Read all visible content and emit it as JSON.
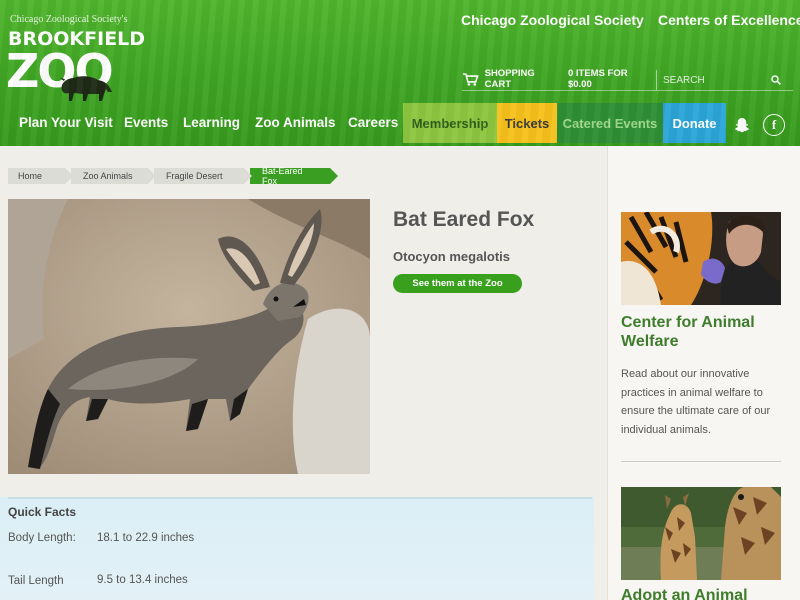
{
  "header": {
    "logo": {
      "society": "Chicago Zoological Society's",
      "name_top": "BROOKFIELD",
      "name_bottom": "ZOO"
    },
    "top_links": [
      "Chicago Zoological Society",
      "Centers of Excellence"
    ],
    "cart": {
      "label": "SHOPPING CART",
      "summary": "0 ITEMS FOR $0.00"
    },
    "search": {
      "placeholder": "SEARCH"
    },
    "nav": [
      "Plan Your Visit",
      "Events",
      "Learning",
      "Zoo Animals",
      "Careers"
    ],
    "nav_boxes": [
      {
        "label": "Membership",
        "bg": "#8dc63f",
        "color": "#2f5d1a"
      },
      {
        "label": "Tickets",
        "bg": "#f6c11b",
        "color": "#3a3a3a"
      },
      {
        "label": "Catered Events",
        "bg": "#2e8f35",
        "color": "#9fd98a"
      },
      {
        "label": "Donate",
        "bg": "#2ba5d8",
        "color": "#ffffff"
      }
    ]
  },
  "breadcrumbs": [
    "Home",
    "Zoo Animals",
    "Fragile Desert",
    "Bat-Eared Fox"
  ],
  "animal": {
    "name": "Bat Eared Fox",
    "scientific_name": "Otocyon megalotis",
    "cta": "See them at the Zoo",
    "photo_icon": "bat-eared-fox-photo"
  },
  "quick_facts": {
    "title": "Quick Facts",
    "rows": [
      {
        "label": "Body Length:",
        "value": "18.1 to 22.9 inches"
      },
      {
        "label": "Tail Length",
        "value": "9.5 to 13.4 inches"
      }
    ]
  },
  "sidebar": {
    "card1": {
      "title": "Center for Animal Welfare",
      "text": "Read about our innovative practices in animal welfare to ensure the ultimate care of our individual animals."
    },
    "card2": {
      "title": "Adopt an Animal"
    }
  },
  "colors": {
    "brand_green": "#3fa523",
    "title_green": "#3f7d2d"
  }
}
